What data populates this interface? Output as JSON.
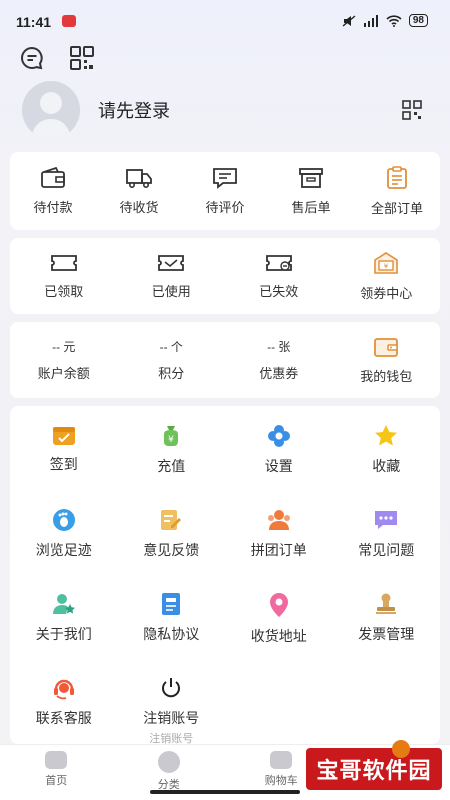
{
  "status_bar": {
    "time": "11:41",
    "battery": "98",
    "signal_icons": [
      "mute-icon",
      "signal-icon",
      "wifi-icon"
    ]
  },
  "top_icons": [
    "message-icon",
    "scan-icon"
  ],
  "profile": {
    "login_text": "请先登录"
  },
  "orders": [
    {
      "label": "待付款",
      "icon": "wallet-icon"
    },
    {
      "label": "待收货",
      "icon": "truck-icon"
    },
    {
      "label": "待评价",
      "icon": "comment-icon"
    },
    {
      "label": "售后单",
      "icon": "box-icon"
    },
    {
      "label": "全部订单",
      "icon": "clipboard-icon"
    }
  ],
  "coupons": [
    {
      "label": "已领取",
      "icon": "ticket-icon"
    },
    {
      "label": "已使用",
      "icon": "ticket-used-icon"
    },
    {
      "label": "已失效",
      "icon": "ticket-expired-icon"
    },
    {
      "label": "领券中心",
      "icon": "coupon-center-icon"
    }
  ],
  "assets": [
    {
      "value": "-- 元",
      "label": "账户余额"
    },
    {
      "value": "-- 个",
      "label": "积分"
    },
    {
      "value": "-- 张",
      "label": "优惠券"
    },
    {
      "value": "",
      "label": "我的钱包",
      "icon": "wallet-orange-icon"
    }
  ],
  "services": [
    {
      "label": "签到",
      "icon": "calendar-icon",
      "color": "#f0a020"
    },
    {
      "label": "充值",
      "icon": "money-bag-icon",
      "color": "#6fc25a"
    },
    {
      "label": "设置",
      "icon": "gear-icon",
      "color": "#3a8ee6"
    },
    {
      "label": "收藏",
      "icon": "star-icon",
      "color": "#f5c518"
    },
    {
      "label": "浏览足迹",
      "icon": "footprint-icon",
      "color": "#3a9ee6"
    },
    {
      "label": "意见反馈",
      "icon": "feedback-icon",
      "color": "#f0c060"
    },
    {
      "label": "拼团订单",
      "icon": "group-icon",
      "color": "#f07a3a"
    },
    {
      "label": "常见问题",
      "icon": "faq-icon",
      "color": "#a08af0"
    },
    {
      "label": "关于我们",
      "icon": "person-star-icon",
      "color": "#4ec0a0"
    },
    {
      "label": "隐私协议",
      "icon": "document-icon",
      "color": "#3a8ee6"
    },
    {
      "label": "收货地址",
      "icon": "location-pin-icon",
      "color": "#f06aa0"
    },
    {
      "label": "发票管理",
      "icon": "stamp-icon",
      "color": "#d8a860"
    },
    {
      "label": "联系客服",
      "icon": "headset-icon",
      "color": "#f05a3a"
    },
    {
      "label": "注销账号",
      "sub": "注销账号",
      "icon": "power-icon",
      "color": "#222222"
    }
  ],
  "tabbar": [
    {
      "label": "首页",
      "icon": "home-icon"
    },
    {
      "label": "分类",
      "icon": "category-icon"
    },
    {
      "label": "购物车",
      "icon": "cart-icon"
    },
    {
      "label": "",
      "icon": "me-icon"
    }
  ],
  "watermark": "宝哥软件园"
}
